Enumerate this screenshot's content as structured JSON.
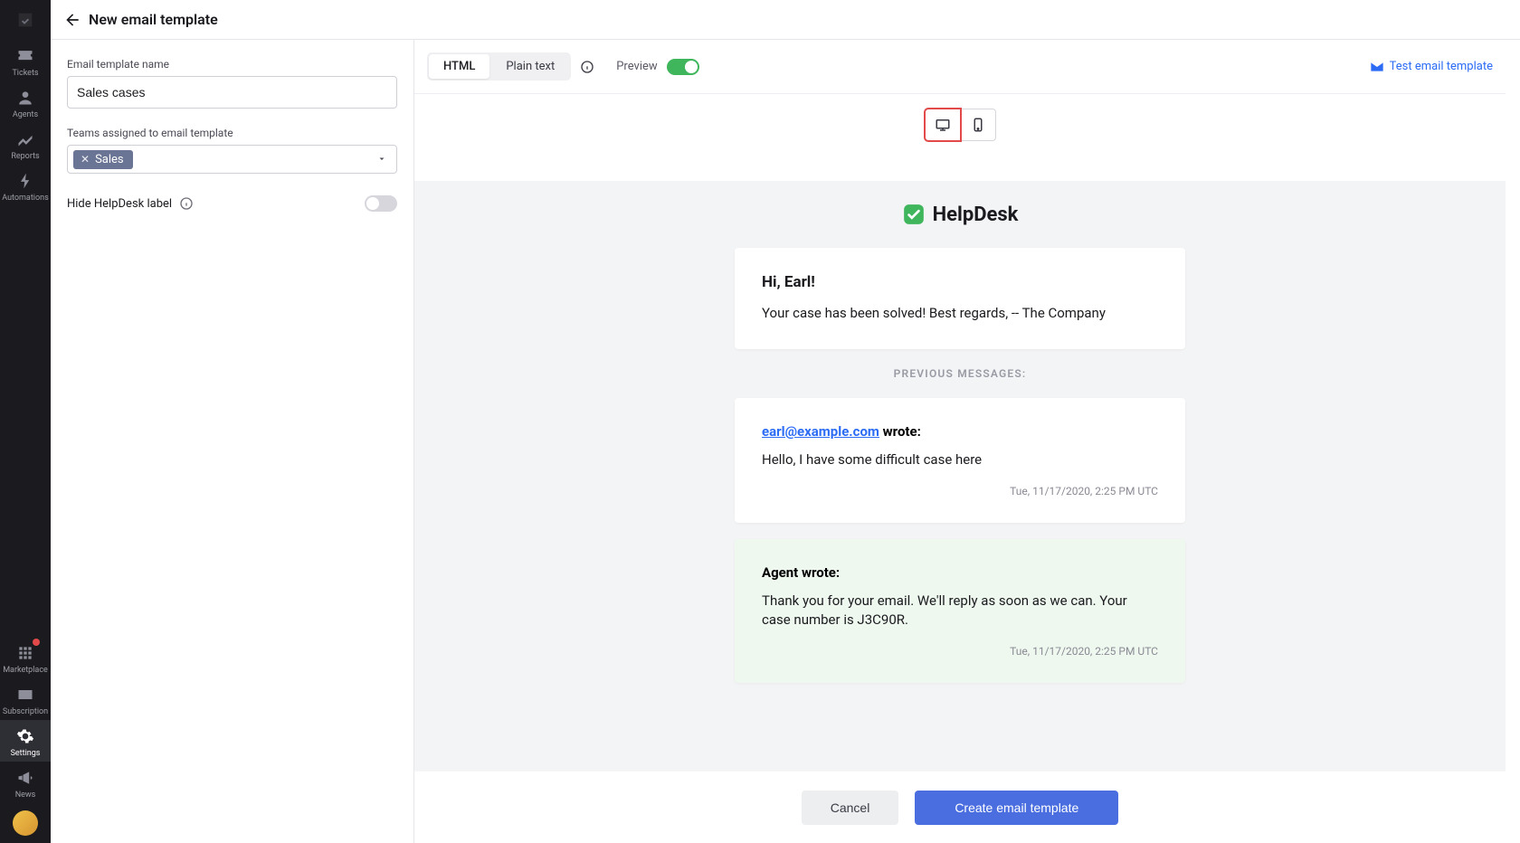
{
  "sidebar": {
    "items": [
      {
        "id": "tickets",
        "label": "Tickets"
      },
      {
        "id": "agents",
        "label": "Agents"
      },
      {
        "id": "reports",
        "label": "Reports"
      },
      {
        "id": "automations",
        "label": "Automations"
      }
    ],
    "bottom_items": [
      {
        "id": "marketplace",
        "label": "Marketplace",
        "has_badge": true
      },
      {
        "id": "subscription",
        "label": "Subscription"
      },
      {
        "id": "settings",
        "label": "Settings",
        "active": true
      },
      {
        "id": "news",
        "label": "News"
      }
    ]
  },
  "header": {
    "title": "New email template"
  },
  "form": {
    "name_label": "Email template name",
    "name_value": "Sales cases",
    "teams_label": "Teams assigned to email template",
    "teams_chip": "Sales",
    "hide_label_text": "Hide HelpDesk label",
    "hide_label_enabled": false
  },
  "toolbar": {
    "html_tab": "HTML",
    "plain_tab": "Plain text",
    "preview_label": "Preview",
    "preview_on": true,
    "test_link": "Test email template"
  },
  "device": {
    "active": "desktop"
  },
  "preview": {
    "brand": "HelpDesk",
    "greeting": "Hi, Earl!",
    "body": "Your case has been solved! Best regards, -- The Company",
    "previous_label": "PREVIOUS MESSAGES:",
    "quote1": {
      "email": "earl@example.com",
      "wrote": " wrote:",
      "body": "Hello, I have some difficult case here",
      "timestamp": "Tue, 11/17/2020, 2:25 PM UTC"
    },
    "quote2": {
      "author": "Agent wrote:",
      "body": "Thank you for your email. We'll reply as soon as we can. Your case number is J3C90R.",
      "timestamp": "Tue, 11/17/2020, 2:25 PM UTC"
    }
  },
  "footer": {
    "cancel": "Cancel",
    "create": "Create email template"
  }
}
